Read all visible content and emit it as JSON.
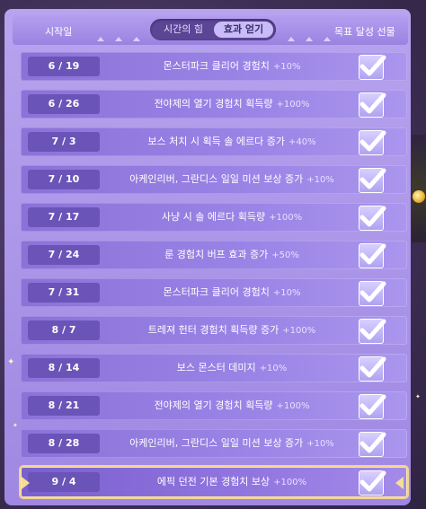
{
  "header": {
    "start_label": "시작일",
    "goal_label": "목표 달성 선물",
    "tabs": [
      {
        "label": "시간의 힘"
      },
      {
        "label": "효과 얻기"
      }
    ]
  },
  "rows": [
    {
      "date": "6 / 19",
      "desc": "몬스터파크 클리어 경험치",
      "bonus": "+10%"
    },
    {
      "date": "6 / 26",
      "desc": "전야제의 열기 경험치 획득량",
      "bonus": "+100%"
    },
    {
      "date": "7 / 3",
      "desc": "보스 처치 시 획득 솔 에르다 증가",
      "bonus": "+40%"
    },
    {
      "date": "7 / 10",
      "desc": "아케인리버, 그란디스 일일 미션 보상 증가",
      "bonus": "+10%"
    },
    {
      "date": "7 / 17",
      "desc": "사냥 시 솔 에르다 획득량",
      "bonus": "+100%"
    },
    {
      "date": "7 / 24",
      "desc": "룬 경험치 버프 효과 증가",
      "bonus": "+50%"
    },
    {
      "date": "7 / 31",
      "desc": "몬스터파크 클리어 경험치",
      "bonus": "+10%"
    },
    {
      "date": "8 / 7",
      "desc": "트레져 헌터 경험치 획득량 증가",
      "bonus": "+100%"
    },
    {
      "date": "8 / 14",
      "desc": "보스 몬스터 데미지",
      "bonus": "+10%"
    },
    {
      "date": "8 / 21",
      "desc": "전야제의 열기 경험치 획득량",
      "bonus": "+100%"
    },
    {
      "date": "8 / 28",
      "desc": "아케인리버, 그란디스 일일 미션 보상 증가",
      "bonus": "+10%"
    },
    {
      "date": "9 / 4",
      "desc": "에픽 던전 기본 경험치 보상",
      "bonus": "+100%"
    }
  ]
}
